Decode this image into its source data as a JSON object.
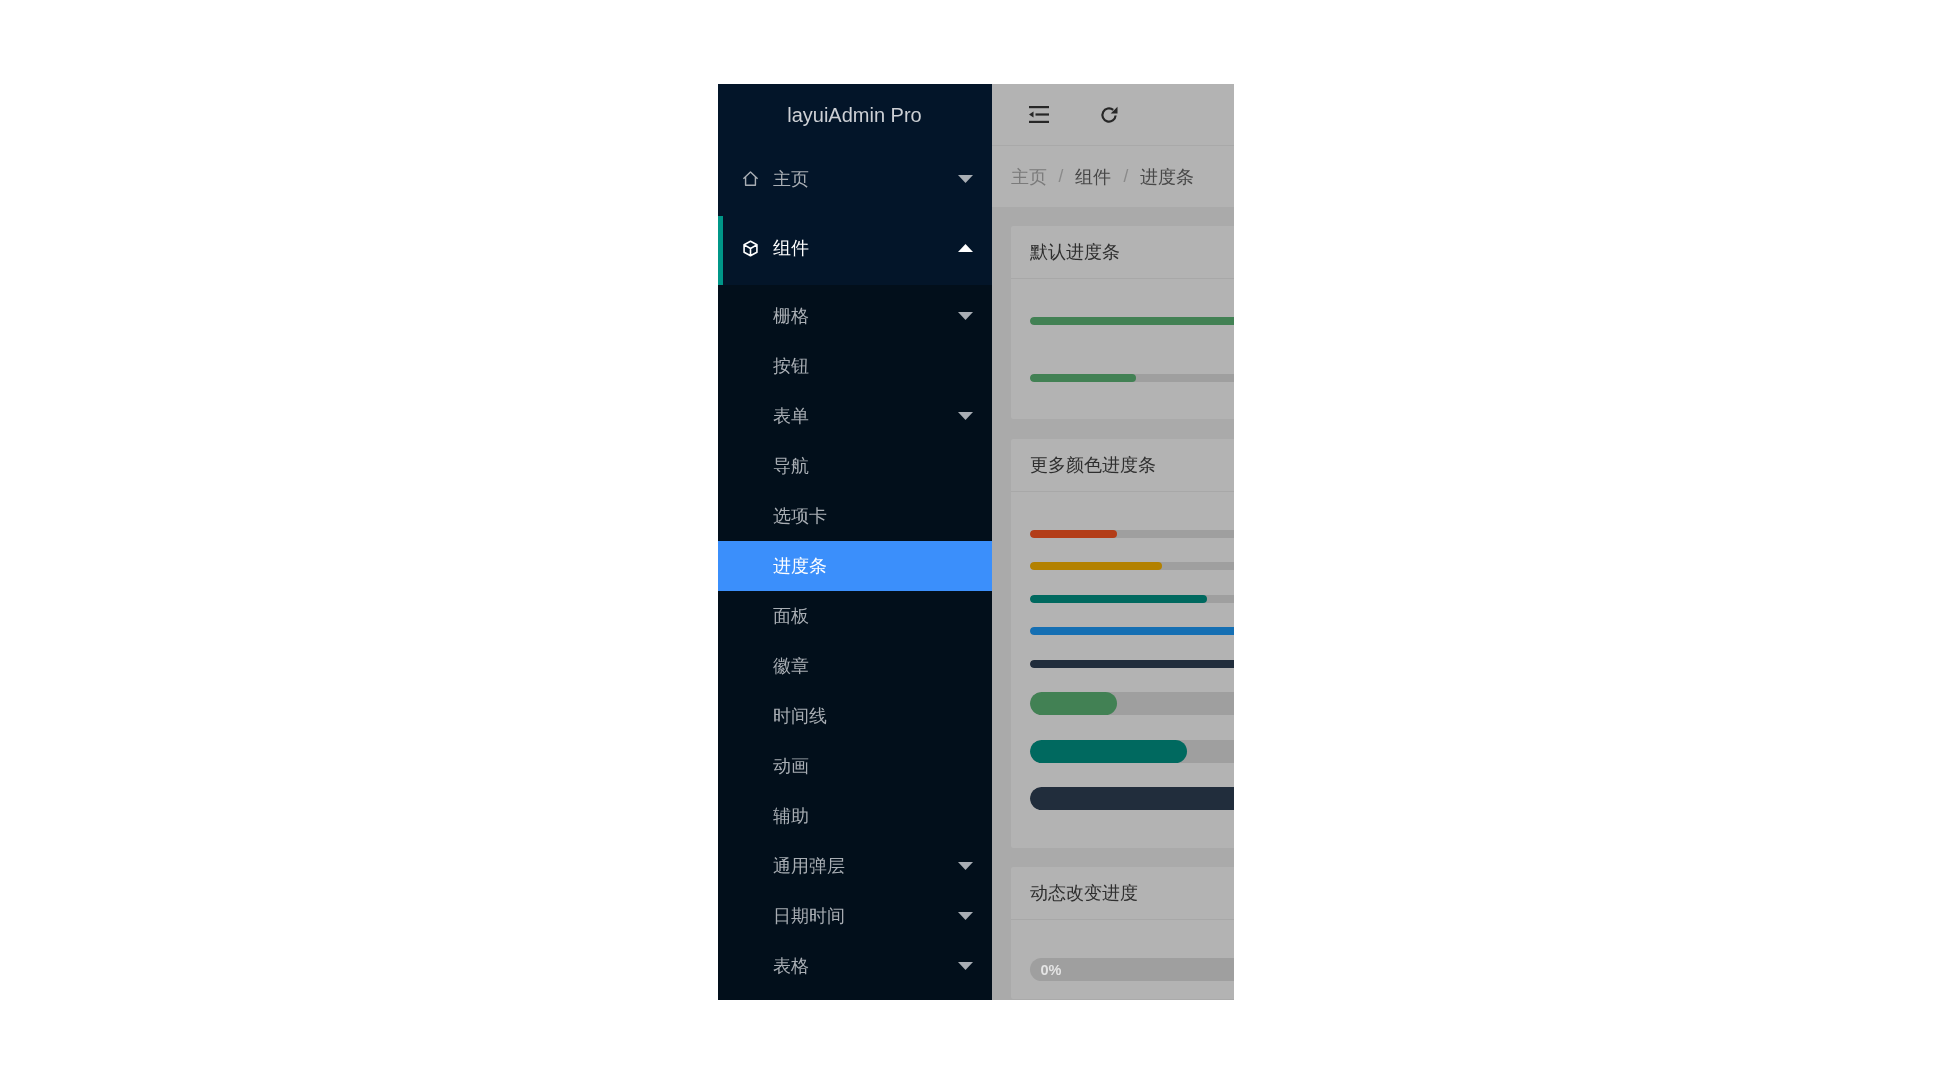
{
  "sidebar": {
    "logo": "layuiAdmin Pro",
    "items": [
      {
        "label": "主页",
        "expanded": false
      },
      {
        "label": "组件",
        "expanded": true,
        "children": [
          {
            "label": "栅格",
            "kind": "group",
            "expanded": false,
            "selected": false
          },
          {
            "label": "按钮",
            "kind": "link",
            "selected": false
          },
          {
            "label": "表单",
            "kind": "group",
            "expanded": false,
            "selected": false
          },
          {
            "label": "导航",
            "kind": "link",
            "selected": false
          },
          {
            "label": "选项卡",
            "kind": "link",
            "selected": false
          },
          {
            "label": "进度条",
            "kind": "link",
            "selected": true
          },
          {
            "label": "面板",
            "kind": "link",
            "selected": false
          },
          {
            "label": "徽章",
            "kind": "link",
            "selected": false
          },
          {
            "label": "时间线",
            "kind": "link",
            "selected": false
          },
          {
            "label": "动画",
            "kind": "link",
            "selected": false
          },
          {
            "label": "辅助",
            "kind": "link",
            "selected": false
          },
          {
            "label": "通用弹层",
            "kind": "group",
            "expanded": false,
            "selected": false
          },
          {
            "label": "日期时间",
            "kind": "group",
            "expanded": false,
            "selected": false
          },
          {
            "label": "表格",
            "kind": "group",
            "expanded": false,
            "selected": false
          }
        ]
      }
    ]
  },
  "breadcrumb": [
    {
      "label": "主页",
      "kind": "link"
    },
    {
      "label": "/",
      "kind": "separator"
    },
    {
      "label": "组件",
      "kind": "page"
    },
    {
      "label": "/",
      "kind": "separator"
    },
    {
      "label": "进度条",
      "kind": "page"
    }
  ],
  "cards": [
    {
      "title": "默认进度条",
      "bars": [
        {
          "kind": "thin",
          "level": 1,
          "color": "#428154"
        },
        {
          "kind": "thin",
          "level": 0.52,
          "color": "#428154"
        }
      ]
    },
    {
      "title": "更多颜色进度条",
      "bars": [
        {
          "kind": "thin",
          "level": 0.43,
          "color": "#b33d18"
        },
        {
          "kind": "thin",
          "level": 0.65,
          "color": "#b38100"
        },
        {
          "kind": "thin",
          "level": 0.87,
          "color": "#00695f"
        },
        {
          "kind": "thin",
          "level": 1,
          "color": "#156fb3"
        },
        {
          "kind": "thin",
          "level": 1,
          "color": "#212d3c"
        },
        {
          "kind": "big",
          "level": 0.43,
          "color": "#428154"
        },
        {
          "kind": "big",
          "level": 0.77,
          "color": "#00695f"
        },
        {
          "kind": "big",
          "level": 1,
          "color": "#212d3c"
        }
      ]
    },
    {
      "title": "动态改变进度",
      "bars": [
        {
          "kind": "big",
          "level": 0,
          "text": "0%"
        }
      ]
    }
  ]
}
